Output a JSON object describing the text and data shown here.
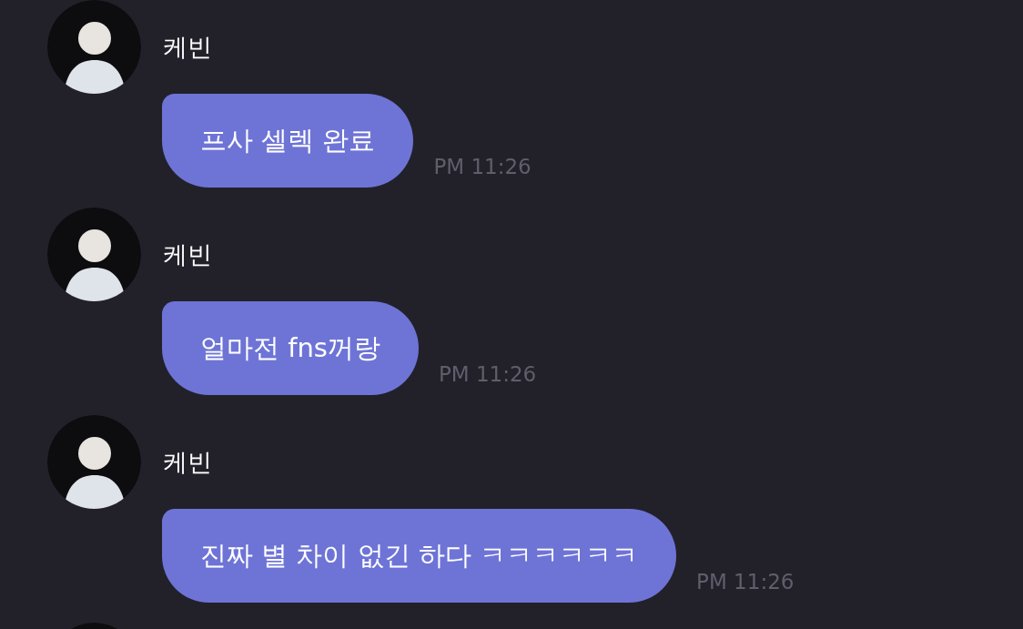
{
  "messages": [
    {
      "sender": "케빈",
      "text": "프사 셀렉 완료",
      "time": "PM 11:26"
    },
    {
      "sender": "케빈",
      "text": "얼마전 fns꺼랑",
      "time": "PM 11:26"
    },
    {
      "sender": "케빈",
      "text": "진짜 별 차이 없긴 하다 ㅋㅋㅋㅋㅋㅋ",
      "time": "PM 11:26"
    }
  ]
}
